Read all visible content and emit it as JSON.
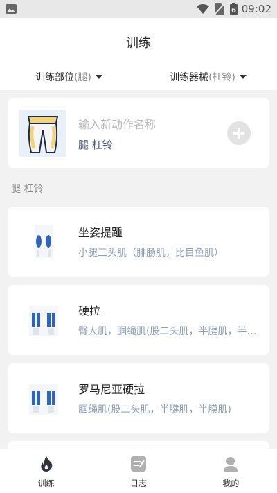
{
  "status_bar": {
    "time": "09:02",
    "battery_glyph": "6"
  },
  "header": {
    "title": "训练",
    "filters": [
      {
        "label": "训练部位",
        "selected": "(腿)"
      },
      {
        "label": "训练器械",
        "selected": "(杠铃)"
      }
    ]
  },
  "new_exercise": {
    "placeholder": "输入新动作名称",
    "tags": "腿 杠铃"
  },
  "section_label": "腿 杠铃",
  "exercises": [
    {
      "name": "坐姿提踵",
      "muscles": "小腿三头肌（腓肠肌，比目鱼肌）"
    },
    {
      "name": "硬拉",
      "muscles": "臀大肌，腘绳肌(股二头肌，半腱肌，半膜肌)"
    },
    {
      "name": "罗马尼亚硬拉",
      "muscles": "腘绳肌(股二头肌，半腱肌，半膜肌)"
    }
  ],
  "tabs": [
    {
      "label": "训练",
      "icon": "flame-icon",
      "active": true
    },
    {
      "label": "日志",
      "icon": "notebook-icon",
      "active": false
    },
    {
      "label": "我的",
      "icon": "person-icon",
      "active": false
    }
  ],
  "colors": {
    "accent": "#3a6fbf",
    "muscle_highlight": "#2f65b4",
    "tab_inactive": "#b0b0b0",
    "tab_active": "#2f3640"
  }
}
